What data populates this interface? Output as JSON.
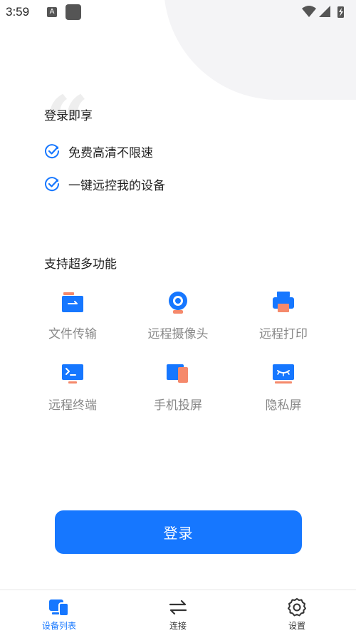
{
  "status_bar": {
    "time": "3:59",
    "notification_letter": "A"
  },
  "intro": {
    "title": "登录即享",
    "benefits": [
      {
        "text": "免费高清不限速",
        "icon": "check-circle-icon"
      },
      {
        "text": "一键远控我的设备",
        "icon": "check-circle-icon"
      }
    ]
  },
  "features": {
    "title": "支持超多功能",
    "items": [
      {
        "label": "文件传输",
        "icon": "folder-transfer-icon"
      },
      {
        "label": "远程摄像头",
        "icon": "webcam-icon"
      },
      {
        "label": "远程打印",
        "icon": "printer-icon"
      },
      {
        "label": "远程终端",
        "icon": "terminal-icon"
      },
      {
        "label": "手机投屏",
        "icon": "screen-cast-icon"
      },
      {
        "label": "隐私屏",
        "icon": "privacy-screen-icon"
      }
    ]
  },
  "login_button": "登录",
  "tabbar": {
    "tabs": [
      {
        "label": "设备列表",
        "icon": "devices-icon",
        "active": true
      },
      {
        "label": "连接",
        "icon": "swap-arrows-icon",
        "active": false
      },
      {
        "label": "设置",
        "icon": "gear-icon",
        "active": false
      }
    ]
  },
  "colors": {
    "primary": "#1677ff",
    "accent_orange": "#f5896b",
    "muted_text": "#888888"
  }
}
